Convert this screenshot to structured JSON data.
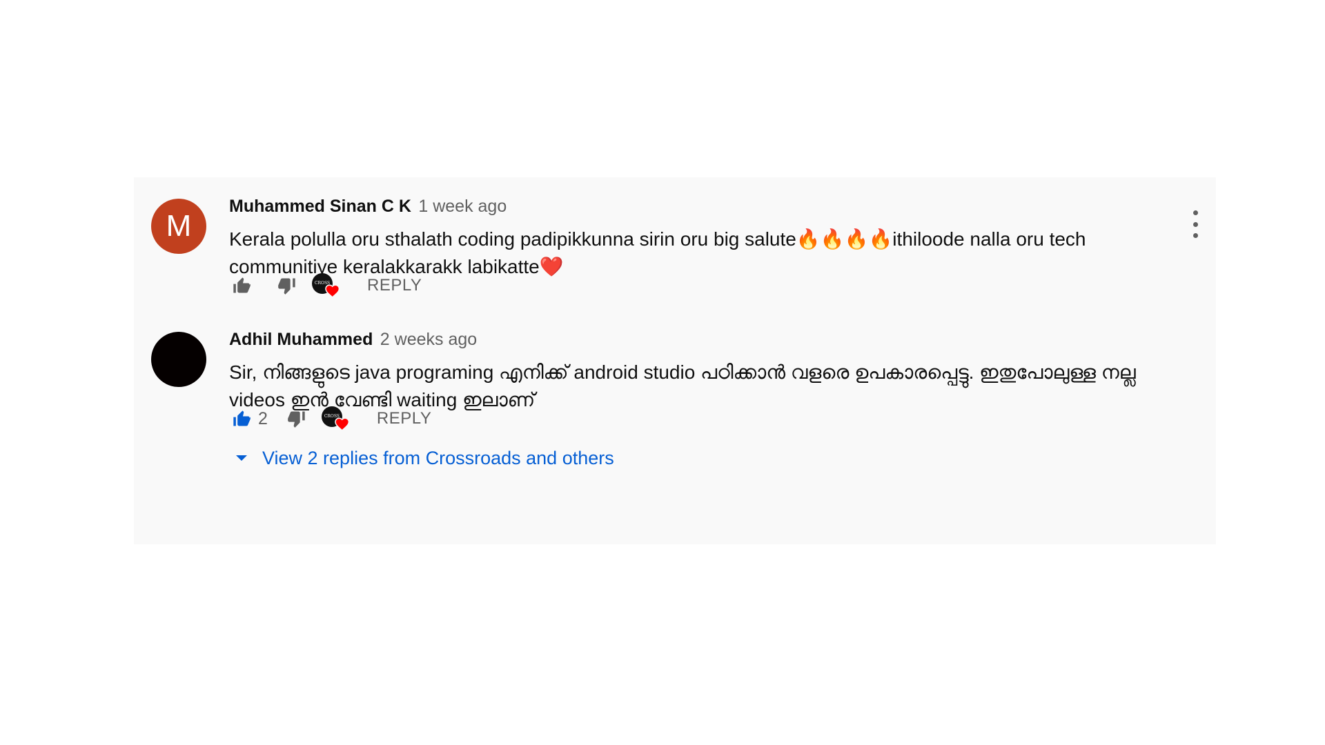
{
  "comments": [
    {
      "avatar_letter": "M",
      "avatar_color": "#c1401e",
      "author": "Muhammed Sinan C K",
      "time": "1 week ago",
      "text": "Kerala polulla oru sthalath coding padipikkunna sirin oru big salute🔥🔥🔥🔥ithiloode nalla oru tech communitiye keralakkarakk labikatte❤️",
      "like_count": "",
      "liked": false,
      "reply_label": "REPLY",
      "creator_heart": true,
      "creator_badge_text": "CROSS"
    },
    {
      "avatar_letter": "",
      "avatar_color": "#050000",
      "author": "Adhil Muhammed",
      "time": "2 weeks ago",
      "text": "Sir, നിങ്ങളുടെ java programing എനിക്ക് android studio പഠിക്കാൻ വളരെ ഉപകാരപ്പെട്ടു. ഇതുപോലുള്ള നല്ല videos ഇൻ വേണ്ടി waiting ഇലാണ്",
      "like_count": "2",
      "liked": true,
      "reply_label": "REPLY",
      "creator_heart": true,
      "creator_badge_text": "CROSS",
      "view_replies_label": "View 2 replies from Crossroads and others"
    }
  ],
  "icons": {
    "like": "thumb-up-icon",
    "dislike": "thumb-down-icon",
    "heart": "heart-icon",
    "more": "more-vert-icon",
    "expand": "caret-down-icon"
  },
  "colors": {
    "panel_bg": "#f9f9f9",
    "link_blue": "#065fd4",
    "liked_blue": "#065fd4",
    "muted": "#606060",
    "heart_red": "#ff0000"
  }
}
